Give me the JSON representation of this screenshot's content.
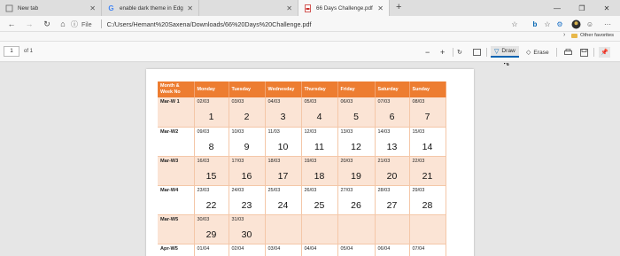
{
  "tabs": [
    {
      "label": "New tab",
      "icon": "page-icon"
    },
    {
      "label": "enable dark theme in Edge - Go",
      "icon": "google-icon"
    },
    {
      "label": "",
      "icon": ""
    },
    {
      "label": "66 Days Challenge.pdf",
      "icon": "pdf-icon"
    }
  ],
  "address": {
    "scheme_label": "File",
    "url": "C:/Users/Hemant%20Saxena/Downloads/66%20Days%20Challenge.pdf"
  },
  "favorites": {
    "other_label": "Other favorites"
  },
  "pdf_toolbar": {
    "page_current": "1",
    "page_total_text": "of 1",
    "draw_label": "Draw",
    "erase_label": "Erase"
  },
  "calendar": {
    "headers": [
      "Month & Week No",
      "Monday",
      "Tuesday",
      "Wednesday",
      "Thursday",
      "Friday",
      "Saturday",
      "Sunday"
    ],
    "rows": [
      {
        "week": "Mar-W 1",
        "cells": [
          {
            "date": "02/03",
            "num": "1"
          },
          {
            "date": "03/03",
            "num": "2"
          },
          {
            "date": "04/03",
            "num": "3"
          },
          {
            "date": "05/03",
            "num": "4"
          },
          {
            "date": "06/03",
            "num": "5"
          },
          {
            "date": "07/03",
            "num": "6"
          },
          {
            "date": "08/03",
            "num": "7"
          }
        ]
      },
      {
        "week": "Mar-W2",
        "cells": [
          {
            "date": "09/03",
            "num": "8"
          },
          {
            "date": "10/03",
            "num": "9"
          },
          {
            "date": "11/03",
            "num": "10"
          },
          {
            "date": "12/03",
            "num": "11"
          },
          {
            "date": "13/03",
            "num": "12"
          },
          {
            "date": "14/03",
            "num": "13"
          },
          {
            "date": "15/03",
            "num": "14"
          }
        ]
      },
      {
        "week": "Mar-W3",
        "cells": [
          {
            "date": "16/03",
            "num": "15"
          },
          {
            "date": "17/03",
            "num": "16"
          },
          {
            "date": "18/03",
            "num": "17"
          },
          {
            "date": "19/03",
            "num": "18"
          },
          {
            "date": "20/03",
            "num": "19"
          },
          {
            "date": "21/03",
            "num": "20"
          },
          {
            "date": "22/03",
            "num": "21"
          }
        ]
      },
      {
        "week": "Mar-W4",
        "cells": [
          {
            "date": "23/03",
            "num": "22"
          },
          {
            "date": "24/03",
            "num": "23"
          },
          {
            "date": "25/03",
            "num": "24"
          },
          {
            "date": "26/03",
            "num": "25"
          },
          {
            "date": "27/03",
            "num": "26"
          },
          {
            "date": "28/03",
            "num": "27"
          },
          {
            "date": "29/03",
            "num": "28"
          }
        ]
      },
      {
        "week": "Mar-W5",
        "cells": [
          {
            "date": "30/03",
            "num": "29"
          },
          {
            "date": "31/03",
            "num": "30"
          },
          {
            "date": "",
            "num": ""
          },
          {
            "date": "",
            "num": ""
          },
          {
            "date": "",
            "num": ""
          },
          {
            "date": "",
            "num": ""
          },
          {
            "date": "",
            "num": ""
          }
        ]
      },
      {
        "week": "Apr-W5",
        "cells": [
          {
            "date": "01/04",
            "num": ""
          },
          {
            "date": "02/04",
            "num": ""
          },
          {
            "date": "03/04",
            "num": ""
          },
          {
            "date": "04/04",
            "num": ""
          },
          {
            "date": "05/04",
            "num": ""
          },
          {
            "date": "06/04",
            "num": ""
          },
          {
            "date": "07/04",
            "num": ""
          }
        ]
      }
    ]
  },
  "colors": {
    "header_orange": "#ed7d31",
    "row_peach": "#fbe4d5",
    "accent_blue": "#0063b1"
  }
}
